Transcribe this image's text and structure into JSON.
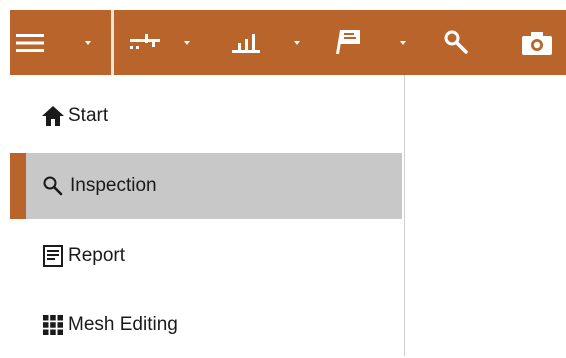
{
  "toolbar": {
    "accent_color": "#b9642a",
    "items": [
      {
        "name": "hamburger-menu",
        "icon": "hamburger-icon",
        "has_dropdown": true
      },
      {
        "name": "alignment",
        "icon": "align-icon",
        "has_dropdown": true
      },
      {
        "name": "measure",
        "icon": "bar-chart-icon",
        "has_dropdown": true
      },
      {
        "name": "report-flag",
        "icon": "flag-icon",
        "has_dropdown": true
      },
      {
        "name": "search",
        "icon": "search-icon",
        "has_dropdown": false
      },
      {
        "name": "camera",
        "icon": "camera-icon",
        "has_dropdown": false
      }
    ]
  },
  "menu": {
    "items": [
      {
        "label": "Start",
        "icon": "home-icon",
        "selected": false
      },
      {
        "label": "Inspection",
        "icon": "search-icon",
        "selected": true
      },
      {
        "label": "Report",
        "icon": "report-icon",
        "selected": false
      },
      {
        "label": "Mesh Editing",
        "icon": "grid-icon",
        "selected": false
      }
    ]
  }
}
